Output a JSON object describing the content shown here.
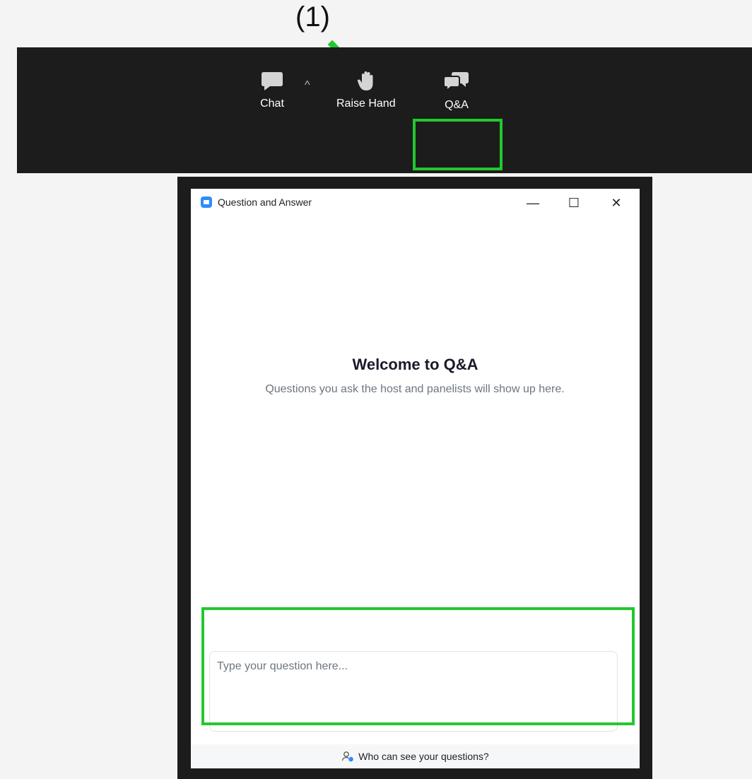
{
  "annotation": {
    "step_label": "(1)",
    "highlight_color": "#22c82f"
  },
  "toolbar": {
    "items": [
      {
        "label": "Chat",
        "icon": "chat-bubble-icon"
      },
      {
        "label": "Raise Hand",
        "icon": "raise-hand-icon"
      },
      {
        "label": "Q&A",
        "icon": "qa-bubbles-icon"
      }
    ],
    "caret": "^"
  },
  "window": {
    "title": "Question and Answer",
    "controls": {
      "minimize": "—",
      "maximize": "☐",
      "close": "✕"
    }
  },
  "qa": {
    "welcome_title": "Welcome to Q&A",
    "welcome_subtitle": "Questions you ask the host and panelists will show up here.",
    "input_placeholder": "Type your question here...",
    "footer_link": "Who can see your questions?"
  }
}
